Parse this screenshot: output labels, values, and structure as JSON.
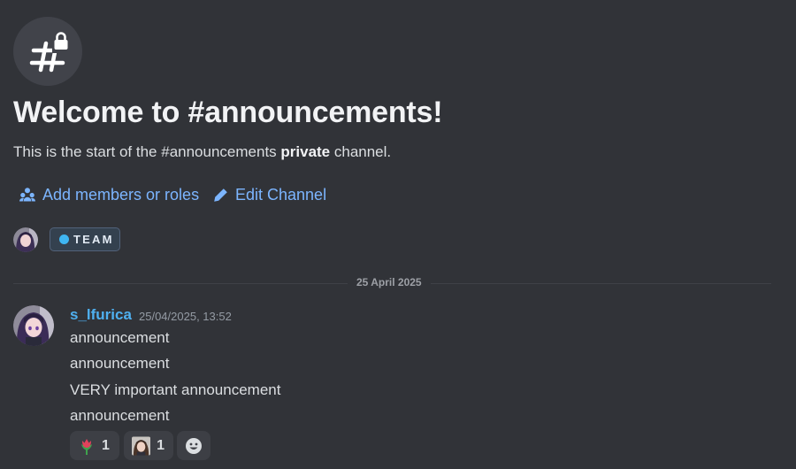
{
  "channel": {
    "icon": "hash-lock-icon",
    "welcome_title": "Welcome to #announcements!",
    "intro_prefix": "This is the start of the #announcements ",
    "intro_bold": "private",
    "intro_suffix": " channel."
  },
  "actions": [
    {
      "label": "Add members or roles",
      "icon": "add-members-icon"
    },
    {
      "label": "Edit Channel",
      "icon": "pencil-icon"
    }
  ],
  "role": {
    "label": "TEAM",
    "color": "#3fb6f2"
  },
  "divider": {
    "date": "25 April 2025"
  },
  "message": {
    "author": "s_lfurica",
    "author_color": "#4fb0f0",
    "timestamp": "25/04/2025, 13:52",
    "lines": [
      "announcement",
      "announcement",
      "VERY important announcement",
      "announcement"
    ],
    "reactions": [
      {
        "emoji": "tulip-emoji",
        "count": "1"
      },
      {
        "emoji": "custom-avatar-emoji",
        "count": "1"
      }
    ],
    "add_reaction_icon": "smiley-add-reaction-icon"
  }
}
